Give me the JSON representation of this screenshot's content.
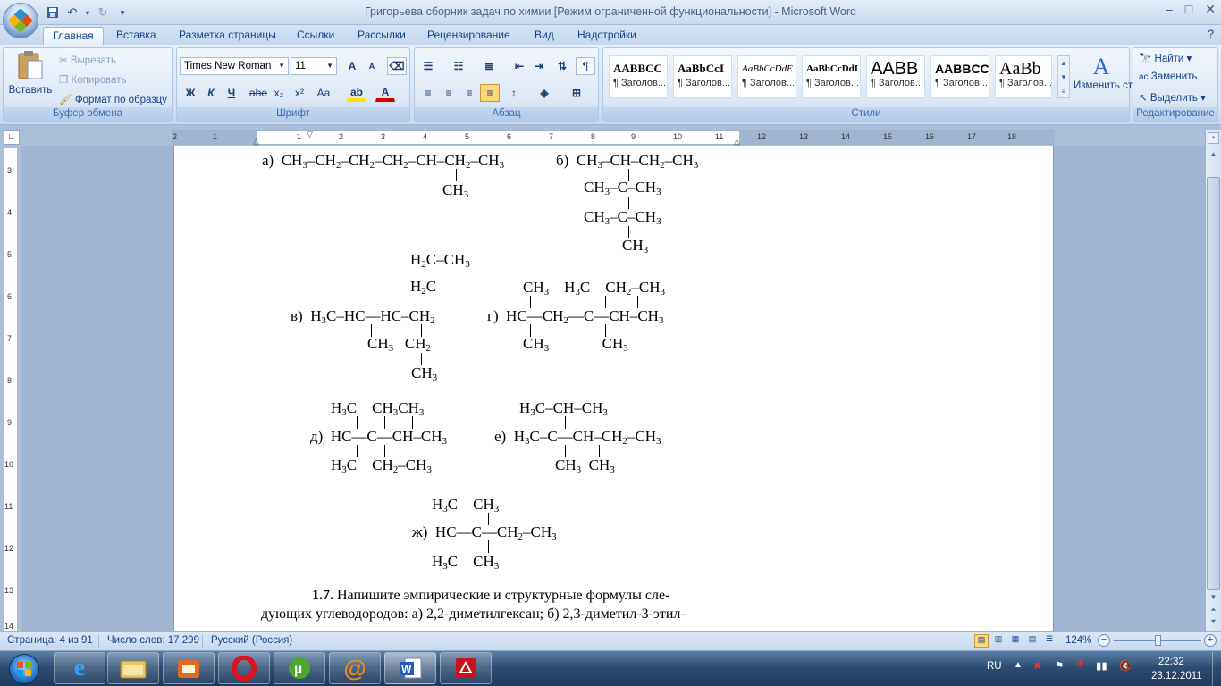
{
  "titlebar": {
    "title": "Григорьева сборник задач по химии [Режим ограниченной функциональности] - Microsoft Word",
    "minimize": "–",
    "maximize": "□",
    "close": "✕"
  },
  "tabs": [
    "Главная",
    "Вставка",
    "Разметка страницы",
    "Ссылки",
    "Рассылки",
    "Рецензирование",
    "Вид",
    "Надстройки"
  ],
  "ribbon": {
    "clipboard": {
      "paste": "Вставить",
      "cut": "Вырезать",
      "copy": "Копировать",
      "format_painter": "Формат по образцу",
      "label": "Буфер обмена"
    },
    "font": {
      "family": "Times New Roman",
      "size": "11",
      "label": "Шрифт",
      "bold": "Ж",
      "italic": "К",
      "underline": "Ч",
      "strike": "abe",
      "sub": "x₂",
      "sup": "x²",
      "case": "Aa",
      "grow": "A",
      "shrink": "A"
    },
    "paragraph": {
      "label": "Абзац"
    },
    "styles": {
      "label": "Стили",
      "items": [
        {
          "preview": "AABBCC",
          "name": "¶ Заголов..."
        },
        {
          "preview": "AaBbCcI",
          "name": "¶ Заголов..."
        },
        {
          "preview": "AaBbCcDdE",
          "name": "¶ Заголов..."
        },
        {
          "preview": "AaBbCcDdI",
          "name": "¶ Заголов..."
        },
        {
          "preview": "AABB",
          "name": "¶ Заголов..."
        },
        {
          "preview": "AABBCC",
          "name": "¶ Заголов..."
        },
        {
          "preview": "AaBb",
          "name": "¶ Заголов..."
        }
      ],
      "change": "Изменить стили"
    },
    "editing": {
      "find": "Найти",
      "replace": "Заменить",
      "select": "Выделить",
      "label": "Редактирование"
    }
  },
  "ruler": {
    "h_ticks": [
      "2",
      "1",
      "1",
      "2",
      "3",
      "4",
      "5",
      "6",
      "7",
      "8",
      "9",
      "10",
      "11",
      "12",
      "13",
      "14",
      "15",
      "16",
      "17",
      "18"
    ],
    "v_ticks": [
      "3",
      "4",
      "5",
      "6",
      "7",
      "8",
      "9",
      "10",
      "11",
      "12",
      "13",
      "14"
    ]
  },
  "document": {
    "labels": {
      "a": "а)",
      "b": "б)",
      "v": "в)",
      "g": "г)",
      "d": "д)",
      "e": "е)",
      "zh": "ж)"
    },
    "paragraph_num": "1.7.",
    "paragraph_line1": "Напишите эмпирические и структурные формулы сле-",
    "paragraph_line2": "дующих углеводородов: а) 2,2-диметилгексан; б) 2,3-диметил-3-этил-"
  },
  "statusbar": {
    "page": "Страница: 4 из 91",
    "words": "Число слов: 17 299",
    "lang": "Русский (Россия)",
    "zoom": "124%"
  },
  "tray": {
    "lang": "RU",
    "time": "22:32",
    "date": "23.12.2011"
  }
}
